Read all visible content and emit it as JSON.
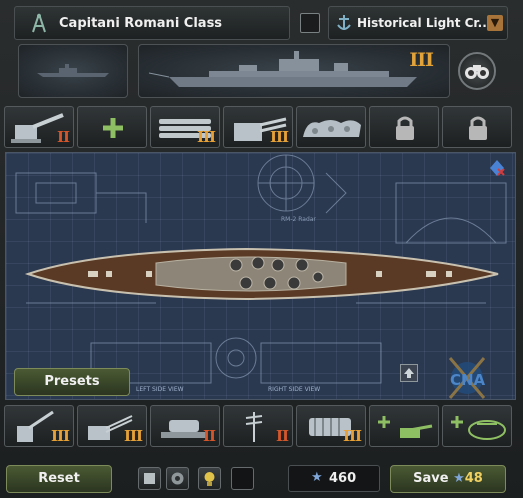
{
  "header": {
    "ship_name": "Capitani Romani Class",
    "role_dropdown": "Historical Light Cr...",
    "tier": "III"
  },
  "top_slots": [
    {
      "icon": "naval-gun-icon",
      "level": "II",
      "level_color": "#d4562a"
    },
    {
      "icon": "add-icon",
      "level": ""
    },
    {
      "icon": "torpedo-launcher-icon",
      "level": "III",
      "level_color": "#e7a137"
    },
    {
      "icon": "twin-gun-turret-icon",
      "level": "III",
      "level_color": "#e7a137"
    },
    {
      "icon": "armor-plate-icon",
      "level": ""
    },
    {
      "icon": "lock-icon",
      "level": ""
    },
    {
      "icon": "lock-icon",
      "level": ""
    }
  ],
  "bottom_slots": [
    {
      "icon": "aa-gun-icon",
      "level": "III",
      "level_color": "#e7a137"
    },
    {
      "icon": "aa-gun-battery-icon",
      "level": "III",
      "level_color": "#e7a137"
    },
    {
      "icon": "fire-control-icon",
      "level": "II",
      "level_color": "#d4562a"
    },
    {
      "icon": "radar-mast-icon",
      "level": "II",
      "level_color": "#d4562a"
    },
    {
      "icon": "engine-icon",
      "level": "III",
      "level_color": "#e7a137"
    },
    {
      "icon": "add-aa-icon",
      "level": ""
    },
    {
      "icon": "add-hull-icon",
      "level": ""
    }
  ],
  "blueprint": {
    "label_left": "LEFT SIDE VIEW",
    "label_right": "RIGHT SIDE VIEW",
    "label_radar": "RM-2 Radar",
    "presets_label": "Presets"
  },
  "footer": {
    "reset_label": "Reset",
    "cost_value": "460",
    "save_label": "Save",
    "save_cost": "48"
  },
  "colors": {
    "accent_orange": "#e7a137",
    "accent_red": "#d4562a",
    "button_green": "#4b5a33",
    "blueprint_bg": "#2a3850"
  }
}
